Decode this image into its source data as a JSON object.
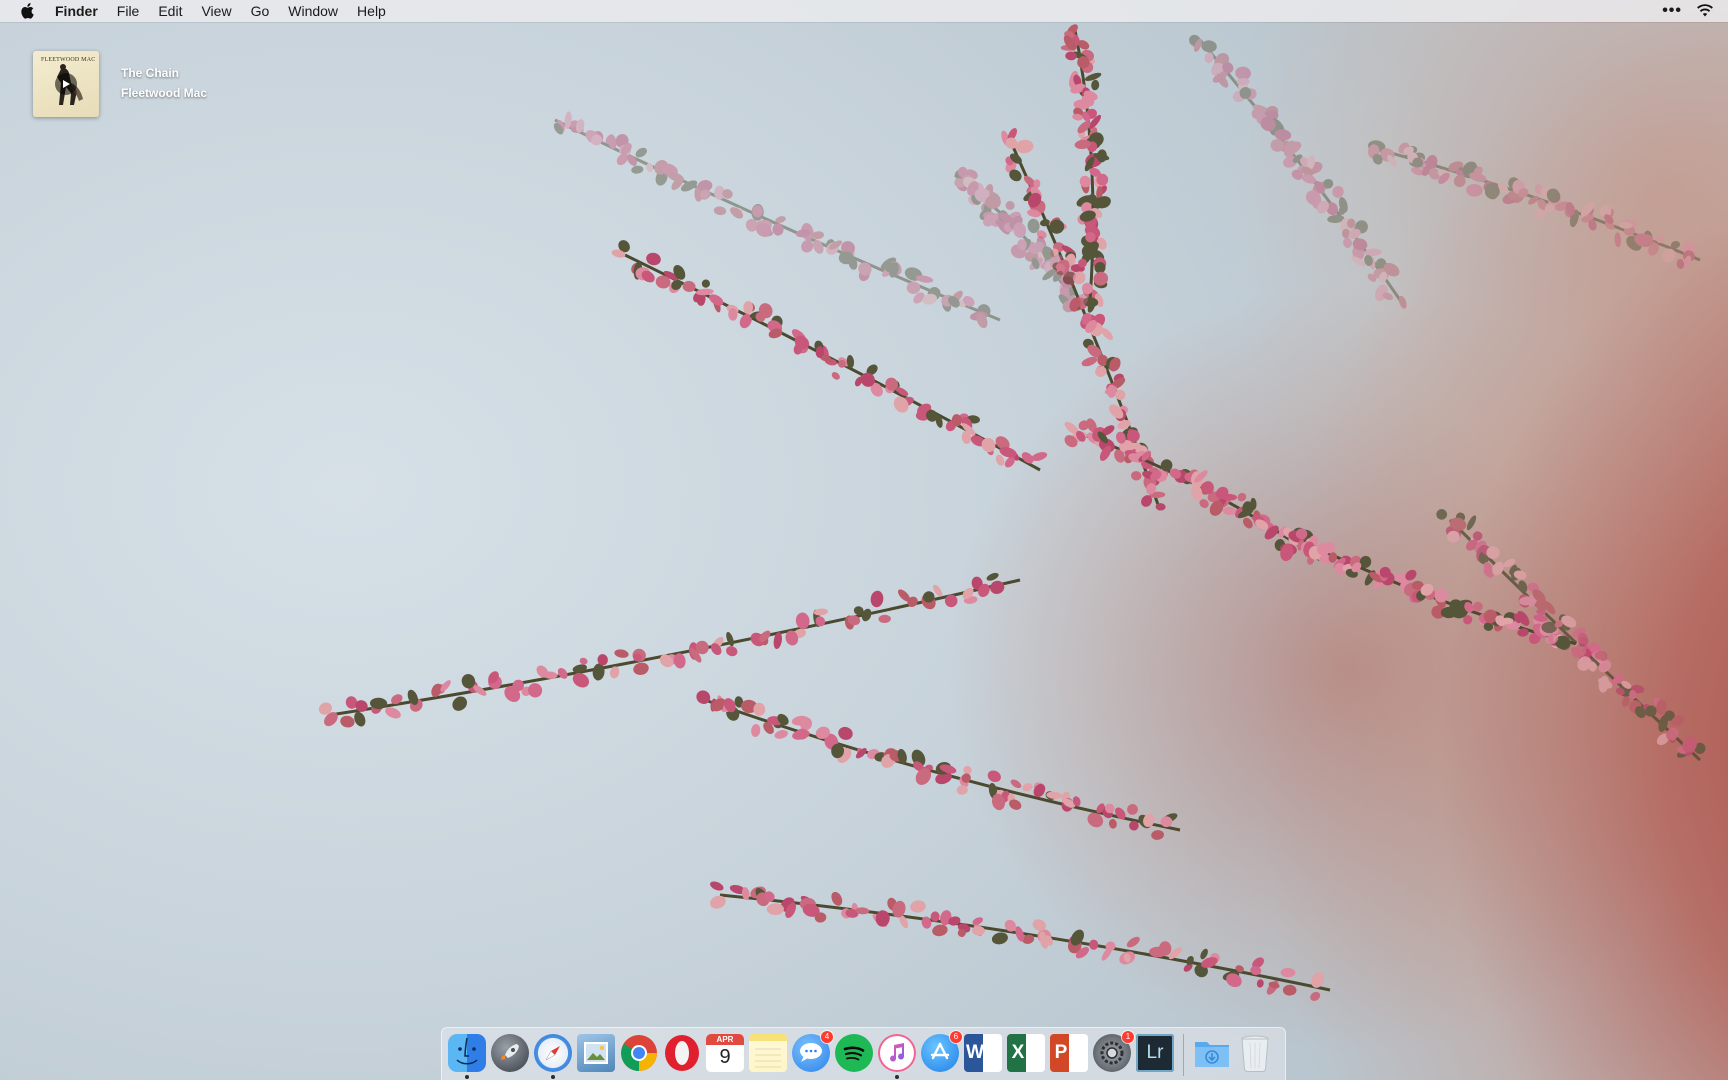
{
  "menubar": {
    "apple_icon": "apple-icon",
    "app_name": "Finder",
    "items": [
      "File",
      "Edit",
      "View",
      "Go",
      "Window",
      "Help"
    ],
    "right_icons": [
      "more-icon",
      "wifi-icon"
    ]
  },
  "now_playing": {
    "track": "The Chain",
    "artist": "Fleetwood Mac",
    "album_band_text": "FLEETWOOD MAC",
    "play_icon": "play-icon"
  },
  "wallpaper": {
    "description_colors": {
      "sky": "#c9d5dd",
      "blossom": "#c8577a",
      "stem": "#4b4a2f",
      "warm": "#b24a3c"
    }
  },
  "dock": {
    "apps": [
      {
        "name": "Finder",
        "icon": "finder-icon",
        "running": true,
        "badge": ""
      },
      {
        "name": "Launchpad",
        "icon": "launchpad-icon",
        "running": false,
        "badge": ""
      },
      {
        "name": "Safari",
        "icon": "safari-icon",
        "running": true,
        "badge": ""
      },
      {
        "name": "Preview",
        "icon": "preview-icon",
        "running": false,
        "badge": ""
      },
      {
        "name": "Chrome",
        "icon": "chrome-icon",
        "running": false,
        "badge": ""
      },
      {
        "name": "Opera",
        "icon": "opera-icon",
        "running": false,
        "badge": ""
      },
      {
        "name": "Calendar",
        "icon": "calendar-icon",
        "running": false,
        "badge": "",
        "month": "APR",
        "day": "9"
      },
      {
        "name": "Notes",
        "icon": "notes-icon",
        "running": false,
        "badge": ""
      },
      {
        "name": "Messages",
        "icon": "messages-icon",
        "running": false,
        "badge": "4"
      },
      {
        "name": "Spotify",
        "icon": "spotify-icon",
        "running": false,
        "badge": ""
      },
      {
        "name": "iTunes",
        "icon": "itunes-icon",
        "running": true,
        "badge": ""
      },
      {
        "name": "App Store",
        "icon": "app-store-icon",
        "running": false,
        "badge": "6"
      },
      {
        "name": "Word",
        "icon": "word-icon",
        "running": false,
        "badge": "",
        "letter": "W"
      },
      {
        "name": "Excel",
        "icon": "excel-icon",
        "running": false,
        "badge": "",
        "letter": "X"
      },
      {
        "name": "PowerPoint",
        "icon": "powerpoint-icon",
        "running": false,
        "badge": "",
        "letter": "P"
      },
      {
        "name": "System Preferences",
        "icon": "system-preferences-icon",
        "running": false,
        "badge": "1"
      },
      {
        "name": "Lightroom",
        "icon": "lightroom-icon",
        "running": false,
        "badge": "",
        "letter": "Lr"
      }
    ],
    "stacks": [
      {
        "name": "Downloads",
        "icon": "downloads-folder-icon"
      },
      {
        "name": "Trash",
        "icon": "trash-icon"
      }
    ]
  }
}
